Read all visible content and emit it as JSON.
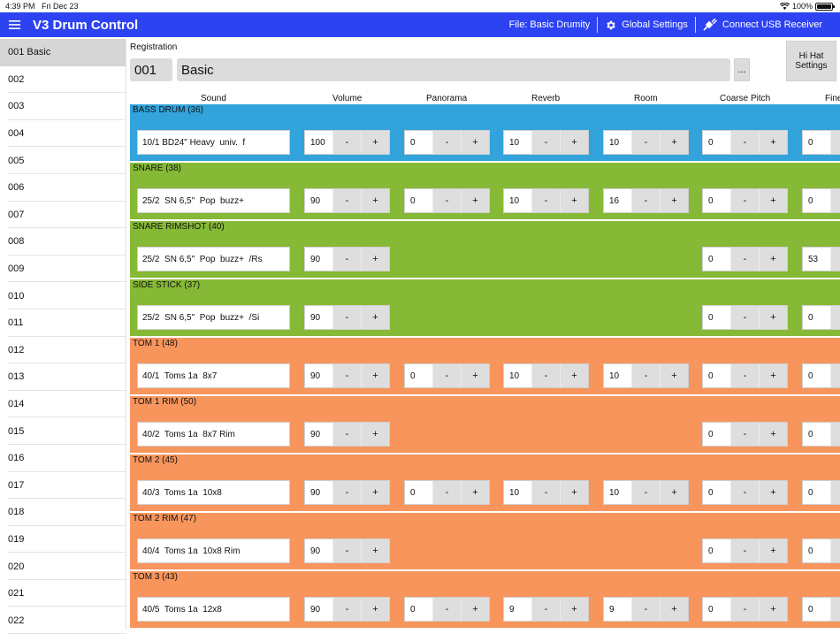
{
  "status_bar": {
    "time": "4:39 PM",
    "date": "Fri Dec 23",
    "battery": "100%",
    "battery_level": 1.0
  },
  "app": {
    "title": "V3 Drum Control"
  },
  "toolbar": {
    "file_label": "File: Basic Drumity",
    "global_settings_label": "Global Settings",
    "connect_label": "Connect USB Receiver"
  },
  "sidebar": {
    "items": [
      "001 Basic",
      "002",
      "003",
      "004",
      "005",
      "006",
      "007",
      "008",
      "009",
      "010",
      "011",
      "012",
      "013",
      "014",
      "015",
      "016",
      "017",
      "018",
      "019",
      "020",
      "021",
      "022"
    ],
    "selected_index": 0
  },
  "registration": {
    "label": "Registration",
    "number": "001",
    "name": "Basic",
    "more_label": "...",
    "hihat_label_1": "Hi Hat",
    "hihat_label_2": "Settings"
  },
  "columns": [
    "Sound",
    "Volume",
    "Panorama",
    "Reverb",
    "Room",
    "Coarse Pitch",
    "Fine"
  ],
  "buttons": {
    "minus": "-",
    "plus": "+"
  },
  "colors": {
    "appbar": "#2d43f2",
    "bass": "#33a3db",
    "snare": "#86b936",
    "tom": "#f7955d"
  },
  "instruments": [
    {
      "title": "BASS DRUM (36)",
      "color": "blue",
      "sound": "10/1 BD24\" Heavy  univ.  f",
      "volume": "100",
      "panorama": "0",
      "reverb": "10",
      "room": "10",
      "coarse_pitch": "0",
      "fine": "0"
    },
    {
      "title": "SNARE (38)",
      "color": "green",
      "sound": "25/2  SN 6,5\"  Pop  buzz+",
      "volume": "90",
      "panorama": "0",
      "reverb": "10",
      "room": "16",
      "coarse_pitch": "0",
      "fine": "0"
    },
    {
      "title": "SNARE RIMSHOT (40)",
      "color": "green",
      "sound": "25/2  SN 6,5\"  Pop  buzz+  /Rs",
      "volume": "90",
      "panorama": null,
      "reverb": null,
      "room": null,
      "coarse_pitch": "0",
      "fine": "53"
    },
    {
      "title": "SIDE STICK (37)",
      "color": "green",
      "sound": "25/2  SN 6,5\"  Pop  buzz+  /Si",
      "volume": "90",
      "panorama": null,
      "reverb": null,
      "room": null,
      "coarse_pitch": "0",
      "fine": "0"
    },
    {
      "title": "TOM 1 (48)",
      "color": "orange",
      "sound": "40/1  Toms 1a  8x7",
      "volume": "90",
      "panorama": "0",
      "reverb": "10",
      "room": "10",
      "coarse_pitch": "0",
      "fine": "0"
    },
    {
      "title": "TOM 1 RIM (50)",
      "color": "orange",
      "sound": "40/2  Toms 1a  8x7 Rim",
      "volume": "90",
      "panorama": null,
      "reverb": null,
      "room": null,
      "coarse_pitch": "0",
      "fine": "0"
    },
    {
      "title": "TOM 2 (45)",
      "color": "orange",
      "sound": "40/3  Toms 1a  10x8",
      "volume": "90",
      "panorama": "0",
      "reverb": "10",
      "room": "10",
      "coarse_pitch": "0",
      "fine": "0"
    },
    {
      "title": "TOM 2 RIM (47)",
      "color": "orange",
      "sound": "40/4  Toms 1a  10x8 Rim",
      "volume": "90",
      "panorama": null,
      "reverb": null,
      "room": null,
      "coarse_pitch": "0",
      "fine": "0"
    },
    {
      "title": "TOM 3 (43)",
      "color": "orange",
      "sound": "40/5  Toms 1a  12x8",
      "volume": "90",
      "panorama": "0",
      "reverb": "9",
      "room": "9",
      "coarse_pitch": "0",
      "fine": "0"
    }
  ]
}
